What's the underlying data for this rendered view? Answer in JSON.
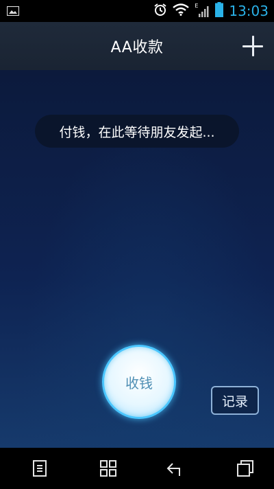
{
  "status_bar": {
    "time": "13:03",
    "icons": [
      "image-icon",
      "alarm-icon",
      "wifi-icon",
      "signal-icon",
      "battery-icon"
    ],
    "signal_label": "E"
  },
  "title_bar": {
    "title": "AA收款",
    "add_icon": "plus-icon"
  },
  "main": {
    "message": "付钱，在此等待朋友发起...",
    "collect_label": "收钱",
    "record_label": "记录"
  },
  "nav_bar": {
    "icons": [
      "menu-icon",
      "apps-icon",
      "back-icon",
      "recents-icon"
    ]
  },
  "colors": {
    "accent": "#2ab2e8",
    "button_glow": "#4ac6ff",
    "button_text": "#4f8fb4"
  }
}
